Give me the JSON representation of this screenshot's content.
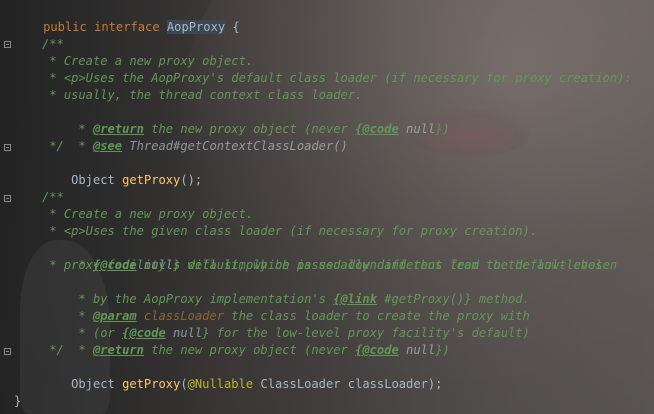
{
  "code": {
    "l1": {
      "kw1": "public ",
      "kw2": "interface ",
      "name": "AopProxy",
      "rest": " {"
    },
    "l3": "/**",
    "l4": " * Create a new proxy object.",
    "l5": " * <p>Uses the AopProxy's default class loader (if necessary for proxy creation):",
    "l6": " * usually, the thread context class loader.",
    "l7": {
      "pre": " * ",
      "tag": "@return",
      "mid": " the new proxy object (never ",
      "code": "{@code",
      "val": " null",
      "end": "})"
    },
    "l8": {
      "pre": " * ",
      "tag": "@see",
      "ref": " Thread",
      "end": "#getContextClassLoader()"
    },
    "l9": " */",
    "l10": {
      "type": "Object ",
      "method": "getProxy",
      "end": "();"
    },
    "l12": "/**",
    "l13": " * Create a new proxy object.",
    "l14": " * <p>Uses the given class loader (if necessary for proxy creation).",
    "l15": {
      "pre": " * ",
      "code": "{@code",
      "val": " null",
      "end": "} will simply be passed down and thus lead to the low-level"
    },
    "l16": " * proxy facility's default, which is usually different from the default chosen",
    "l17": {
      "pre": " * by the AopProxy implementation's ",
      "link": "{@link",
      "end": " #getProxy()} method."
    },
    "l18": {
      "pre": " * ",
      "tag": "@param",
      "param": " classLoader",
      "end": " the class loader to create the proxy with"
    },
    "l19": {
      "pre": " * (or ",
      "code": "{@code",
      "val": " null",
      "end": "} for the low-level proxy facility's default)"
    },
    "l20": {
      "pre": " * ",
      "tag": "@return",
      "mid": " the new proxy object (never ",
      "code": "{@code",
      "val": " null",
      "end": "})"
    },
    "l21": " */",
    "l22": {
      "type": "Object ",
      "method": "getProxy",
      "open": "(",
      "ann": "@Nullable",
      "rest": " ClassLoader classLoader);"
    },
    "l24": "}"
  },
  "colors": {
    "keyword": "#cc7832",
    "method": "#ffc66d",
    "annotation": "#bbb529",
    "doc_comment": "#629755",
    "text": "#a9b7c6"
  }
}
